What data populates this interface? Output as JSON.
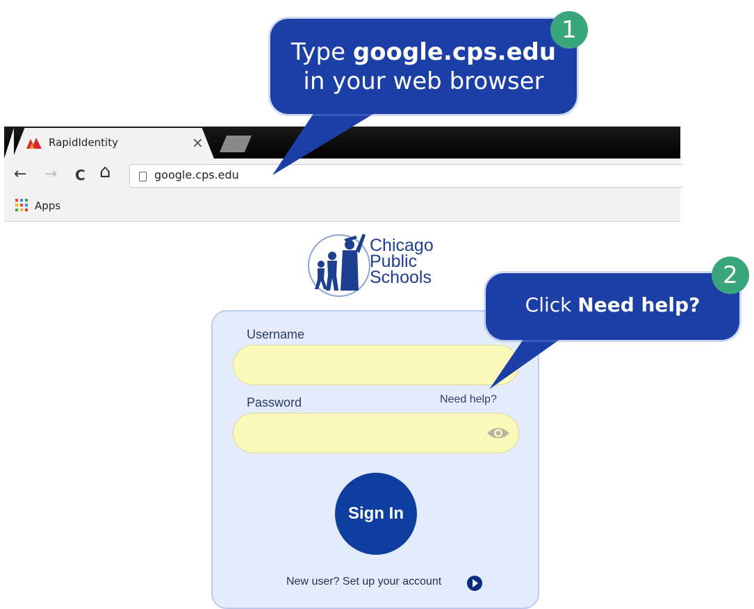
{
  "browser": {
    "tab_title": "RapidIdentity",
    "tab_close": "×",
    "url": "google.cps.edu",
    "nav": {
      "back": "←",
      "forward": "→",
      "reload": "C",
      "home": "⌂"
    },
    "bookmarks": [
      {
        "label": "Apps"
      }
    ]
  },
  "logo": {
    "lines": [
      "Chicago",
      "Public",
      "Schools"
    ]
  },
  "login": {
    "username_label": "Username",
    "username_value": "",
    "password_label": "Password",
    "password_value": "",
    "need_help": "Need help?",
    "sign_in": "Sign In",
    "new_user": "New user? Set up your account"
  },
  "callouts": [
    {
      "number": "1",
      "line1_prefix": "Type ",
      "line1_bold": "google.cps.edu",
      "line2": "in your web browser"
    },
    {
      "number": "2",
      "prefix": "Click ",
      "bold": "Need help?"
    }
  ],
  "colors": {
    "callout": "#1b3fa6",
    "badge": "#39a57a",
    "sign_in": "#0d3ea0",
    "field_fill": "#fbf9ba",
    "card": "#e4ebfb"
  }
}
